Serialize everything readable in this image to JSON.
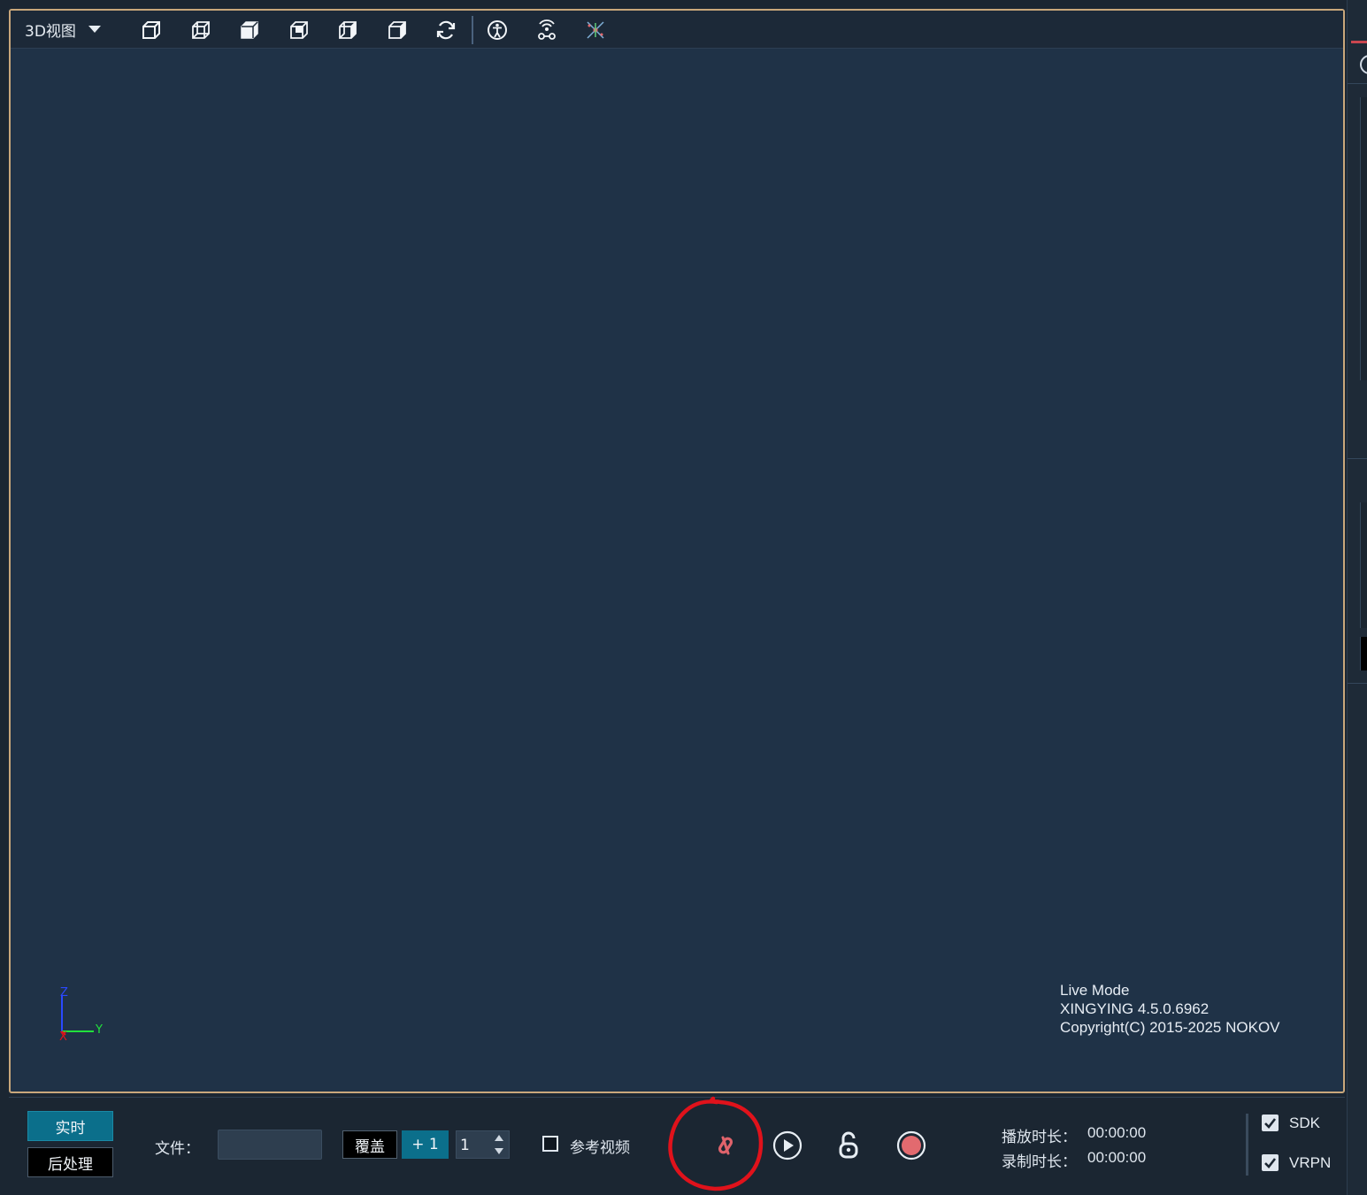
{
  "viewport": {
    "view_select_label": "3D视图",
    "toolbar_icons": [
      "cube-front-icon",
      "cube-perspective-icon",
      "cube-top-icon",
      "cube-iso-icon",
      "cube-side-icon",
      "cube-back-icon",
      "refresh-icon",
      "skeleton-icon",
      "rigid-body-icon",
      "marker-icon"
    ],
    "axis": {
      "z": "Z",
      "y": "Y",
      "x": "X"
    },
    "info": {
      "mode": "Live Mode",
      "version": "XINGYING 4.5.0.6962",
      "copyright": "Copyright(C) 2015-2025 NOKOV"
    }
  },
  "bottom": {
    "live_label": "实时",
    "post_label": "后处理",
    "file_label": "文件：",
    "file_value": "",
    "cover_label": "覆盖",
    "plus_label": "+ 1",
    "spin_value": "1",
    "reference_video_label": "参考视频",
    "playback_duration_label": "播放时长：",
    "playback_duration_value": "00:00:00",
    "record_duration_label": "录制时长：",
    "record_duration_value": "00:00:00",
    "sdk_label": "SDK",
    "vrpn_label": "VRPN"
  },
  "colors": {
    "accent": "#0b6f8b",
    "viewport_border": "#c9a77b",
    "record_red": "#e26a6f",
    "annotation_red": "#e0121b"
  }
}
